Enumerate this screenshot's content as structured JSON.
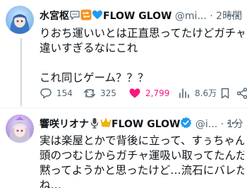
{
  "tweet1": {
    "display_name": "水宮枢",
    "display_name_badge": "FLOW GLOW",
    "handle": "@mi...",
    "separator": "·",
    "time": "2時間",
    "more_label": "···",
    "body_lines": [
      "りおち運いいとは正直思ってたけどガチャが",
      "違いすぎるなにこれ",
      "",
      "これ同じゲーム？？？"
    ],
    "reply_count": "154",
    "retweet_count": "325",
    "like_count": "2,799",
    "view_count": "8.6万",
    "liked": true,
    "colors": {
      "like": "#f91880",
      "heart_badge": "#1d9bf0"
    }
  },
  "tweet2": {
    "display_name": "響咲リオナ",
    "display_name_badge": "FLOW GLOW",
    "handle": "@i...",
    "separator": "·",
    "time": "1分",
    "more_label": "···",
    "verified": true,
    "body_lines": [
      "実は楽屋とかで背後に立って、すぅちゃんの",
      "頭のつむじからガチャ運吸い取ってたんだ…",
      "黙ってようかと思ったけど…流石にバレたよ",
      "ね…"
    ],
    "colors": {
      "verified": "#1d9bf0"
    }
  },
  "icons": {
    "speech_bubble": "speech-bubble-icon",
    "repeat": "repeat-icon",
    "blue_heart": "blue-heart-icon",
    "microphone": "microphone-icon",
    "crown": "crown-icon"
  }
}
